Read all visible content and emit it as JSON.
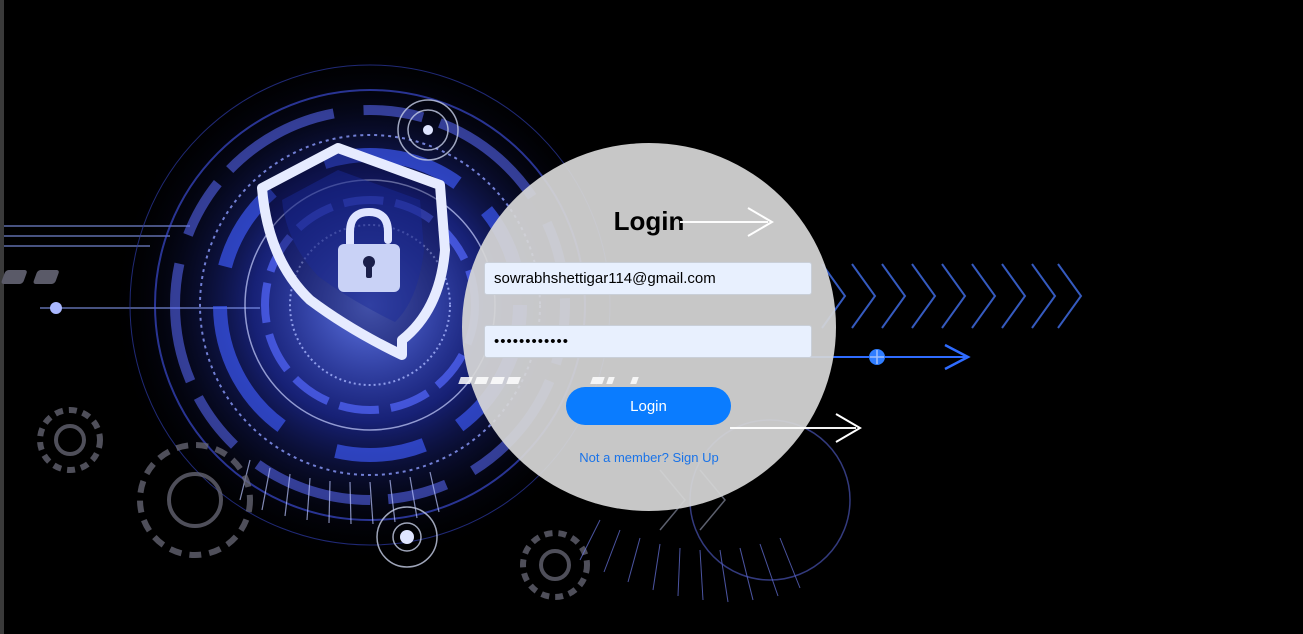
{
  "login": {
    "title": "Login",
    "email_value": "sowrabhshettigar114@gmail.com",
    "password_value": "password1234",
    "button_label": "Login",
    "signup_prefix": "Not a member?",
    "signup_link": "Sign Up"
  },
  "colors": {
    "accent": "#0a7cff",
    "link": "#1a73e8",
    "card": "#d6d6d6",
    "field": "#e8f0fe",
    "background": "#000000",
    "art_blue": "#3a5cff"
  },
  "icons": {
    "background": "cyber-security-shield-lock-illustration"
  }
}
